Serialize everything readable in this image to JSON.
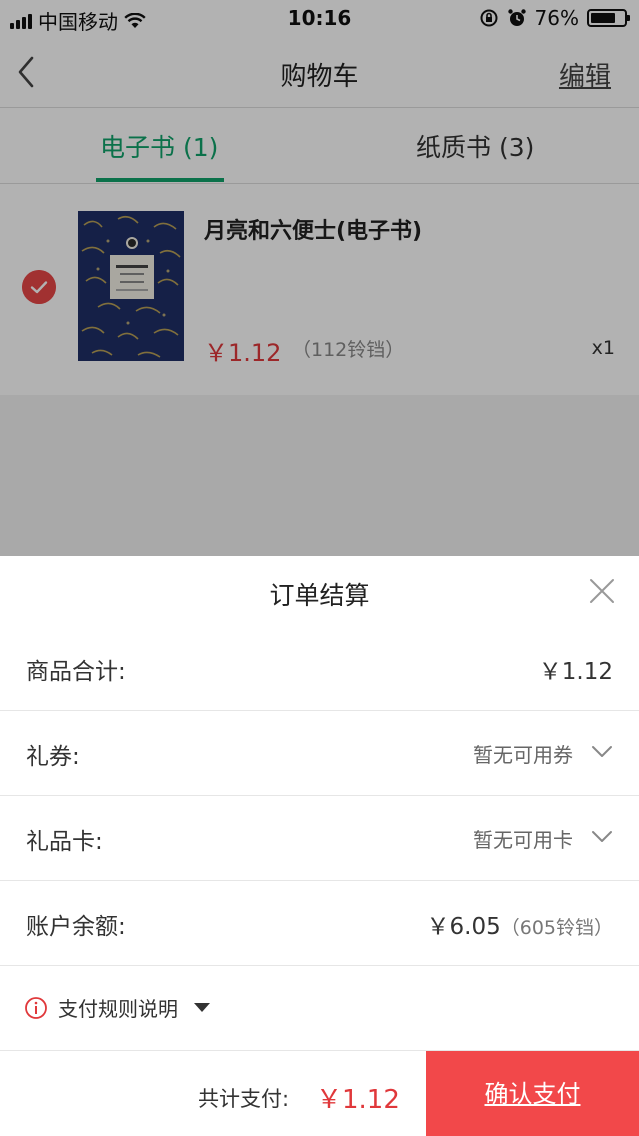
{
  "status_bar": {
    "carrier": "中国移动",
    "time": "10:16",
    "battery": "76%",
    "battery_level": 0.76
  },
  "nav": {
    "title": "购物车",
    "edit_label": "编辑"
  },
  "tabs": [
    {
      "label": "电子书 (1)",
      "active": true
    },
    {
      "label": "纸质书 (3)",
      "active": false
    }
  ],
  "cart_item": {
    "title": "月亮和六便士(电子书)",
    "price": "￥1.12",
    "coins": "（112铃铛）",
    "quantity": "x1",
    "selected": true
  },
  "sheet": {
    "title": "订单结算",
    "rows": [
      {
        "label": "商品合计:",
        "value": "￥1.12"
      },
      {
        "label": "礼券:",
        "value": "暂无可用券"
      },
      {
        "label": "礼品卡:",
        "value": "暂无可用卡"
      },
      {
        "label": "账户余额:",
        "value": "￥6.05",
        "sub": "（605铃铛）"
      }
    ],
    "rules_label": "支付规则说明"
  },
  "footer": {
    "total_label": "共计支付:",
    "total_value": "￥1.12",
    "confirm_label": "确认支付"
  },
  "colors": {
    "accent_green": "#11a36b",
    "price_red": "#e0383b",
    "confirm_red": "#f2484a",
    "check_red": "#e74747"
  }
}
